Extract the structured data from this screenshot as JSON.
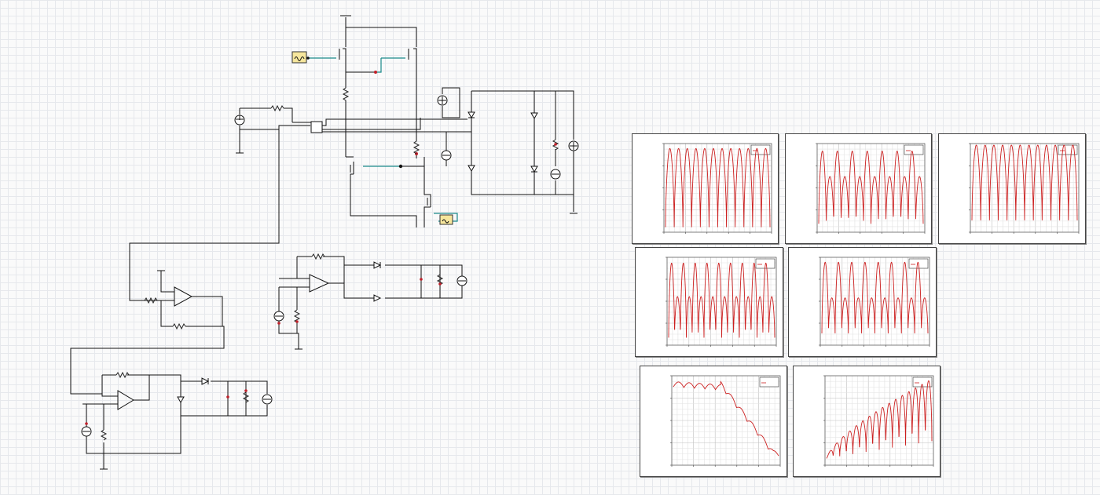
{
  "app": {
    "accent": "#1a8a8a",
    "wire_color": "#111111",
    "trace_color": "#cc1f1f",
    "grid_color": "#e6e8ec"
  },
  "schematic": {
    "components": [
      {
        "type": "signal-source-icon",
        "count": 2
      },
      {
        "type": "mosfet-icon",
        "count": 4
      },
      {
        "type": "diode-icon",
        "count": 10
      },
      {
        "type": "opamp-icon",
        "count": 3
      },
      {
        "type": "voltmeter-icon",
        "count": 7
      },
      {
        "type": "resistor-icon",
        "count": 14
      },
      {
        "type": "ground-icon",
        "count": 6
      }
    ]
  },
  "chart_data": [
    {
      "type": "line",
      "pattern": "osc",
      "n": 14,
      "cycles": 12,
      "base": 0.04,
      "amp": 0.92,
      "alt": 0,
      "trend": 0
    },
    {
      "type": "line",
      "pattern": "osc",
      "n": 14,
      "cycles": 14,
      "base": 0.08,
      "amp": 0.85,
      "alt": 0.35,
      "trend": 0
    },
    {
      "type": "line",
      "pattern": "osc",
      "n": 14,
      "cycles": 12,
      "base": 0.12,
      "amp": 0.88,
      "alt": 0,
      "trend": 0
    },
    {
      "type": "line",
      "pattern": "osc",
      "n": 14,
      "cycles": 18,
      "base": 0.07,
      "amp": 0.88,
      "alt": 0.45,
      "trend": 0
    },
    {
      "type": "line",
      "pattern": "osc",
      "n": 14,
      "cycles": 16,
      "base": 0.12,
      "amp": 0.84,
      "alt": 0.5,
      "trend": 0
    },
    {
      "type": "line",
      "pattern": "decay",
      "n": 14,
      "cycles": 10,
      "start": 0.95,
      "end": 0.15,
      "amp": 0.12
    },
    {
      "type": "line",
      "pattern": "grow",
      "n": 14,
      "cycles": 16,
      "start": 0.06,
      "end": 0.98,
      "amp": 0.55
    }
  ]
}
